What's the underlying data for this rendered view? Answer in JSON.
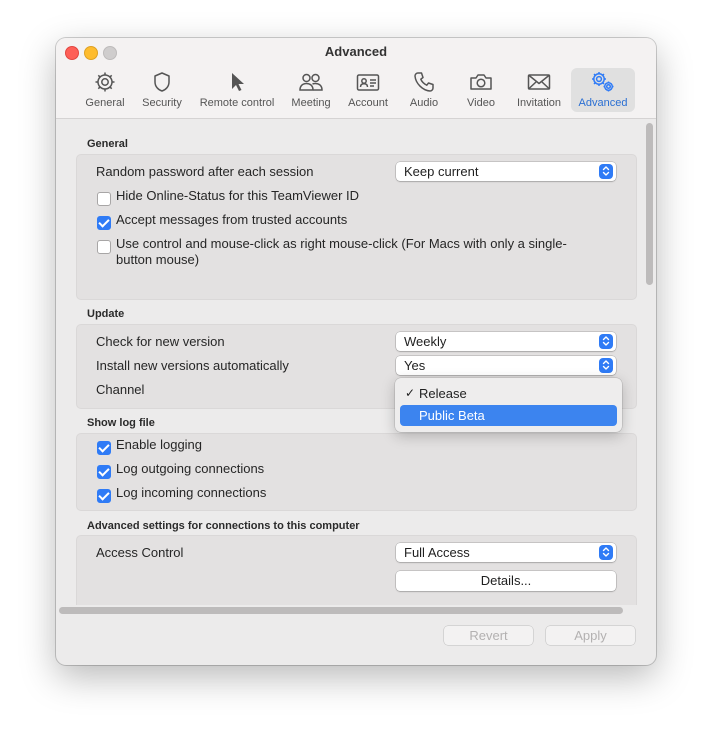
{
  "window": {
    "title": "Advanced"
  },
  "toolbar": {
    "tabs": [
      {
        "label": "General",
        "icon": "gear-icon"
      },
      {
        "label": "Security",
        "icon": "shield-icon"
      },
      {
        "label": "Remote control",
        "icon": "cursor-arrow-icon"
      },
      {
        "label": "Meeting",
        "icon": "people-icon"
      },
      {
        "label": "Account",
        "icon": "id-card-icon"
      },
      {
        "label": "Audio",
        "icon": "phone-icon"
      },
      {
        "label": "Video",
        "icon": "camera-icon"
      },
      {
        "label": "Invitation",
        "icon": "envelope-icon"
      },
      {
        "label": "Advanced",
        "icon": "gears-icon",
        "active": true
      }
    ]
  },
  "general": {
    "title": "General",
    "random_password_label": "Random password after each session",
    "random_password_value": "Keep current",
    "hide_online_status": {
      "label": "Hide Online-Status for this TeamViewer ID",
      "checked": false
    },
    "accept_messages": {
      "label": "Accept messages from trusted accounts",
      "checked": true
    },
    "right_click": {
      "label": "Use control and mouse-click as right mouse-click (For Macs with only a single-",
      "label_line2": "button mouse)",
      "checked": false
    }
  },
  "update": {
    "title": "Update",
    "check_label": "Check for new version",
    "check_value": "Weekly",
    "install_label": "Install new versions automatically",
    "install_value": "Yes",
    "channel_label": "Channel",
    "channel_menu": {
      "options": [
        "Release",
        "Public Beta"
      ],
      "selected": "Release",
      "highlighted": "Public Beta"
    }
  },
  "log": {
    "title": "Show log file",
    "enable_logging": {
      "label": "Enable logging",
      "checked": true
    },
    "log_outgoing": {
      "label": "Log outgoing connections",
      "checked": true
    },
    "log_incoming": {
      "label": "Log incoming connections",
      "checked": true
    }
  },
  "advanced_connections": {
    "title": "Advanced settings for connections to this computer",
    "access_control_label": "Access Control",
    "access_control_value": "Full Access",
    "details_label": "Details..."
  },
  "footer": {
    "revert_label": "Revert",
    "apply_label": "Apply"
  },
  "colors": {
    "accent": "#2f7bf6",
    "menu_highlight": "#3c84ef",
    "active_tab_label": "#2a6fd3"
  }
}
